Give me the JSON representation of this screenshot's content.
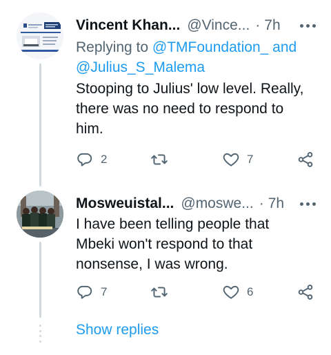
{
  "tweets": [
    {
      "display_name": "Vincent Khan...",
      "handle": "@Vince...",
      "dot": "·",
      "time": "7h",
      "reply_prefix": "Replying to",
      "reply_mention_1": "@TMFoundation_",
      "reply_and": "and",
      "reply_mention_2": "@Julius_S_Malema",
      "text": "Stooping to Julius' low level. Really, there was no need to respond to him.",
      "reply_count": "2",
      "retweet_count": "",
      "like_count": "7"
    },
    {
      "display_name": "Mosweuistal...",
      "handle": "@moswe...",
      "dot": "·",
      "time": "7h",
      "text": "I have been telling people that Mbeki won't respond to that nonsense, I was wrong.",
      "reply_count": "7",
      "retweet_count": "",
      "like_count": "6"
    }
  ],
  "show_replies_label": "Show replies",
  "icons": {
    "reply": "reply-icon",
    "retweet": "retweet-icon",
    "like": "heart-icon",
    "share": "share-icon",
    "more": "more-icon"
  },
  "colors": {
    "link": "#1d9bf0",
    "secondary_text": "#536471",
    "primary_text": "#0f1419",
    "thread_line": "#cfd9de"
  }
}
